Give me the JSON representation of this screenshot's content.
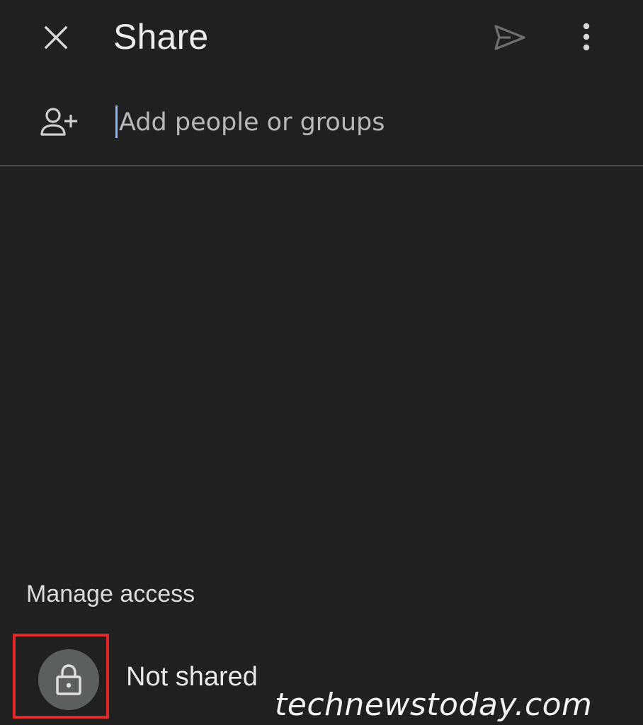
{
  "header": {
    "title": "Share",
    "icons": {
      "close": "close-icon",
      "send": "send-icon",
      "more": "more-vertical-icon"
    }
  },
  "add_people": {
    "icon": "person-add-icon",
    "placeholder": "Add people or groups",
    "value": ""
  },
  "manage_access": {
    "title": "Manage access",
    "status_icon": "lock-icon",
    "status_label": "Not shared"
  },
  "watermark": "technewstoday.com",
  "colors": {
    "background": "#202020",
    "cursor_accent": "#8ab4f8",
    "highlight": "#e3262a",
    "icon_circle": "#5c5f60"
  }
}
